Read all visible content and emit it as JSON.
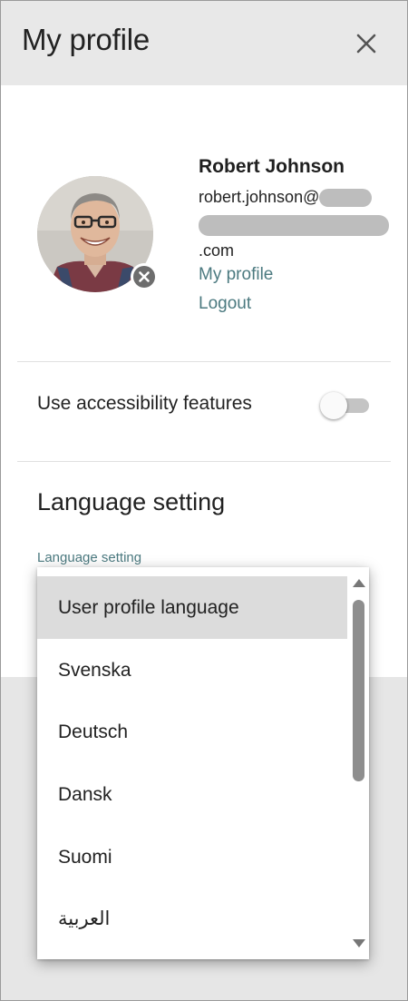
{
  "header": {
    "title": "My profile",
    "close_icon": "close-icon"
  },
  "profile": {
    "name": "Robert Johnson",
    "email_prefix": "robert.johnson@",
    "email_suffix": ".com",
    "my_profile_link": "My profile",
    "logout_link": "Logout",
    "avatar_remove_icon": "remove-x-icon"
  },
  "accessibility": {
    "label": "Use accessibility features",
    "enabled": false
  },
  "language": {
    "section_title": "Language setting",
    "field_label": "Language setting",
    "options": [
      "User profile language",
      "Svenska",
      "Deutsch",
      "Dansk",
      "Suomi",
      "العربية"
    ],
    "selected_index": 0
  },
  "colors": {
    "link": "#4c7a80",
    "header_bg": "#e8e8e8",
    "selected_option_bg": "#dcdcdc"
  }
}
